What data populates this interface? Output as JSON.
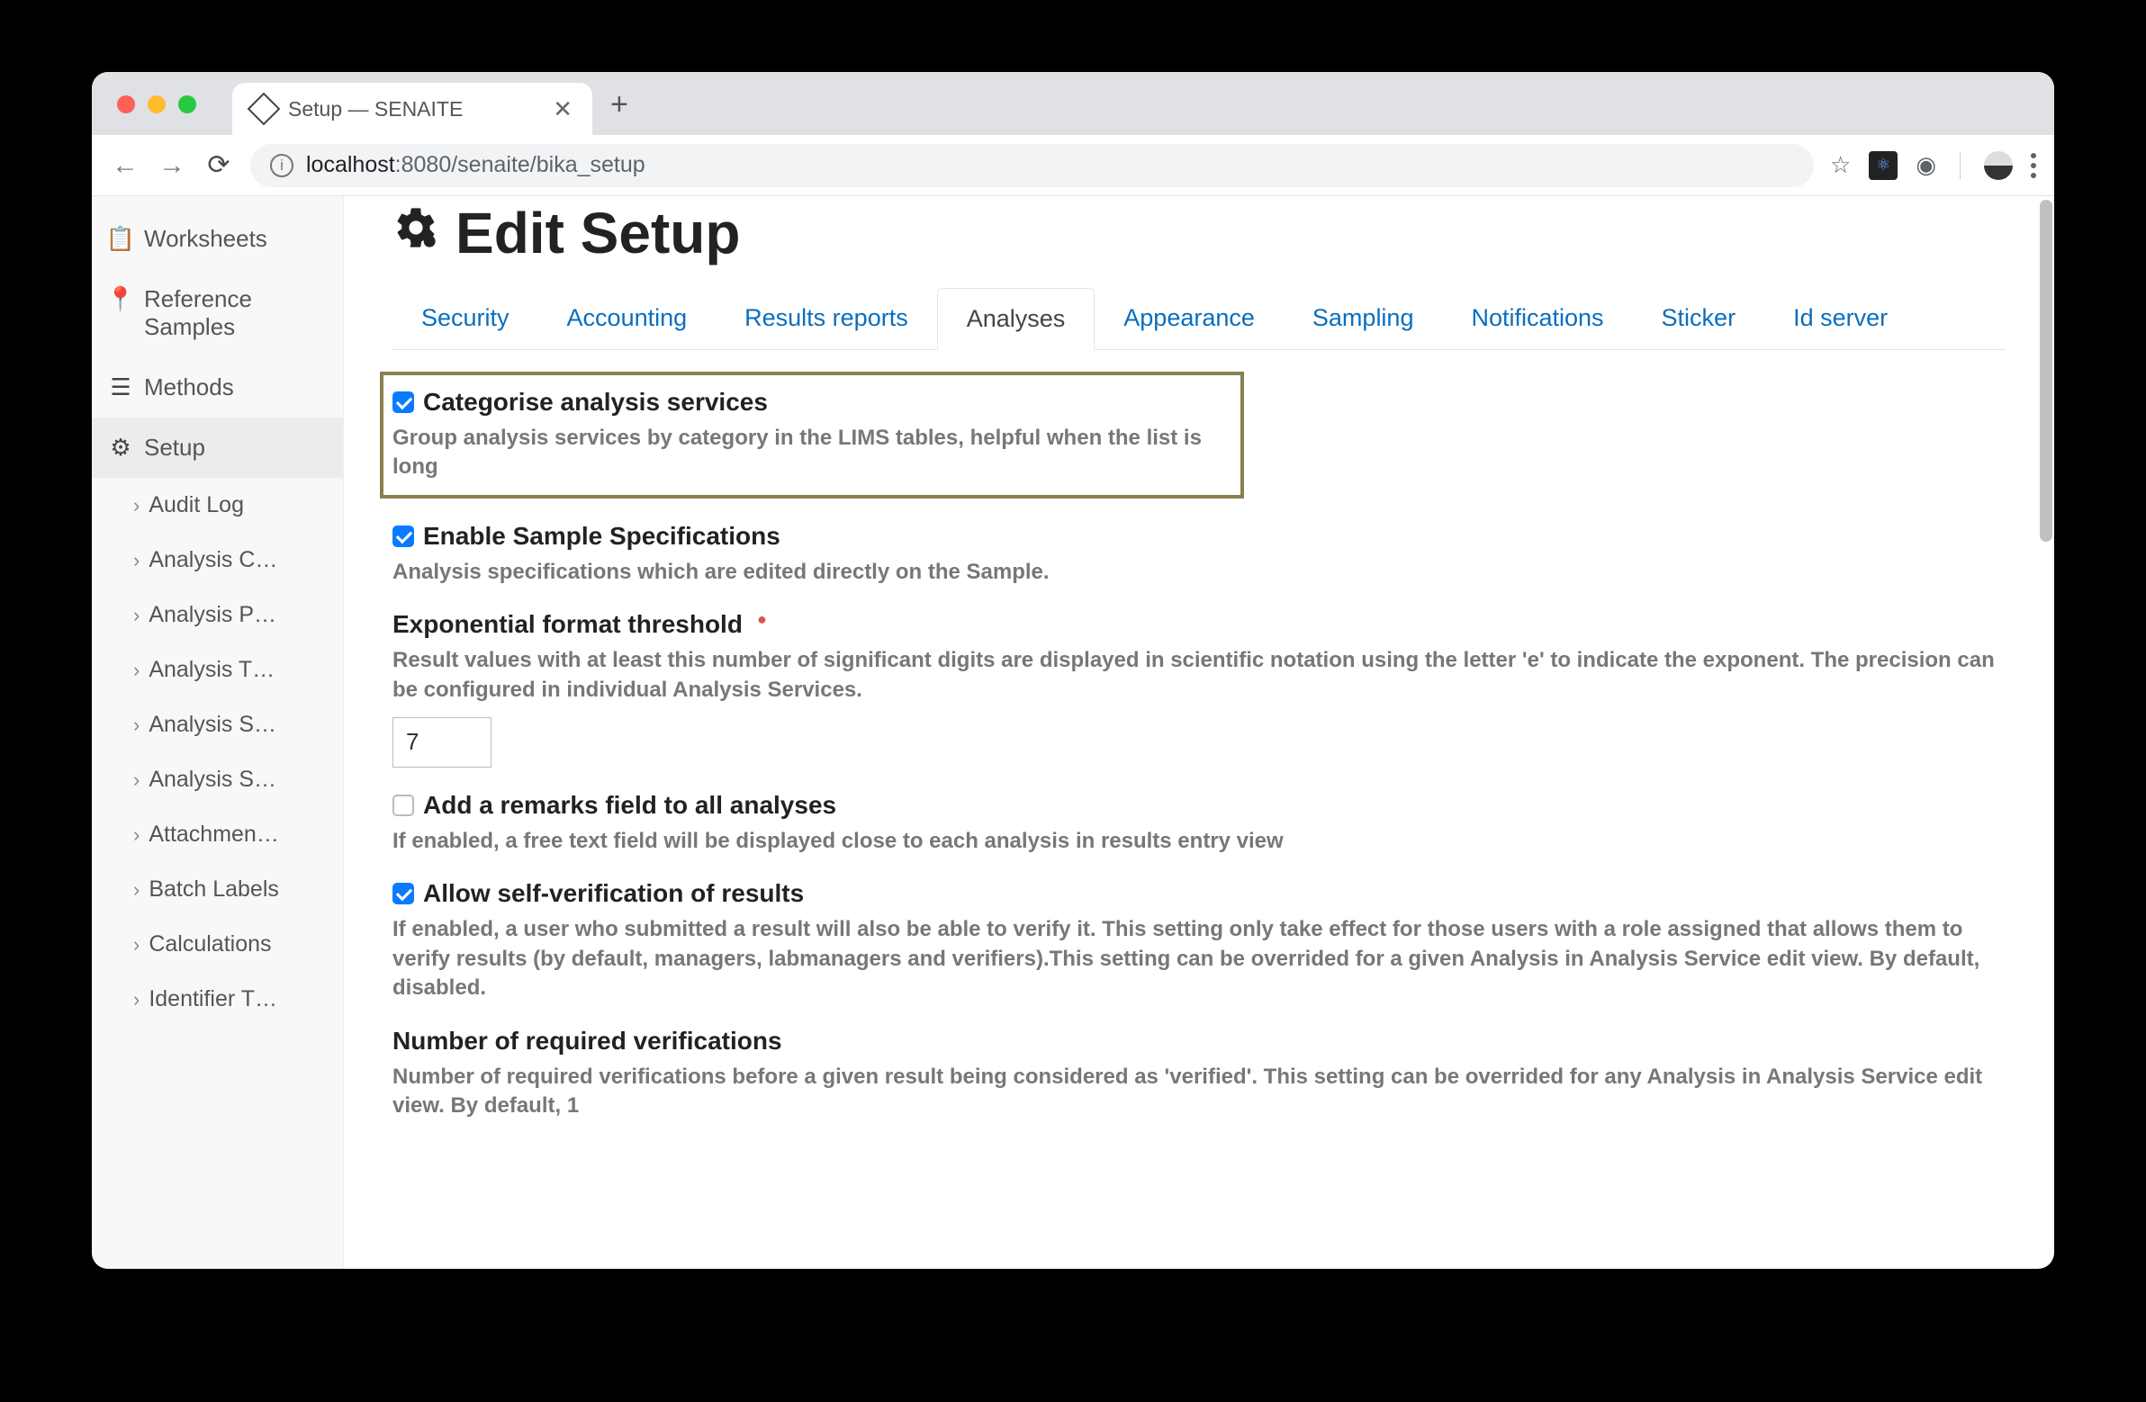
{
  "browser": {
    "tab_title": "Setup — SENAITE",
    "url_host": "localhost",
    "url_port": ":8080",
    "url_path": "/senaite/bika_setup"
  },
  "sidebar": {
    "items": [
      {
        "label": "Worksheets",
        "icon": "📋"
      },
      {
        "label": "Reference Samples",
        "icon": "📍"
      },
      {
        "label": "Methods",
        "icon": "☰"
      },
      {
        "label": "Setup",
        "icon": "⚙"
      }
    ],
    "subitems": [
      {
        "label": "Audit Log"
      },
      {
        "label": "Analysis C…"
      },
      {
        "label": "Analysis P…"
      },
      {
        "label": "Analysis T…"
      },
      {
        "label": "Analysis S…"
      },
      {
        "label": "Analysis S…"
      },
      {
        "label": "Attachmen…"
      },
      {
        "label": "Batch Labels"
      },
      {
        "label": "Calculations"
      },
      {
        "label": "Identifier T…"
      }
    ]
  },
  "page": {
    "title": "Edit Setup"
  },
  "tabs": [
    {
      "label": "Security",
      "active": false
    },
    {
      "label": "Accounting",
      "active": false
    },
    {
      "label": "Results reports",
      "active": false
    },
    {
      "label": "Analyses",
      "active": true
    },
    {
      "label": "Appearance",
      "active": false
    },
    {
      "label": "Sampling",
      "active": false
    },
    {
      "label": "Notifications",
      "active": false
    },
    {
      "label": "Sticker",
      "active": false
    },
    {
      "label": "Id server",
      "active": false
    }
  ],
  "fields": {
    "categorise": {
      "label": "Categorise analysis services",
      "desc": "Group analysis services by category in the LIMS tables, helpful when the list is long",
      "checked": true
    },
    "enable_spec": {
      "label": "Enable Sample Specifications",
      "desc": "Analysis specifications which are edited directly on the Sample.",
      "checked": true
    },
    "exp_threshold": {
      "label": "Exponential format threshold",
      "desc": "Result values with at least this number of significant digits are displayed in scientific notation using the letter 'e' to indicate the exponent. The precision can be configured in individual Analysis Services.",
      "required": true,
      "value": "7"
    },
    "remarks": {
      "label": "Add a remarks field to all analyses",
      "desc": "If enabled, a free text field will be displayed close to each analysis in results entry view",
      "checked": false
    },
    "self_verify": {
      "label": "Allow self-verification of results",
      "desc": "If enabled, a user who submitted a result will also be able to verify it. This setting only take effect for those users with a role assigned that allows them to verify results (by default, managers, labmanagers and verifiers).This setting can be overrided for a given Analysis in Analysis Service edit view. By default, disabled.",
      "checked": true
    },
    "num_verif": {
      "label": "Number of required verifications",
      "desc": "Number of required verifications before a given result being considered as 'verified'. This setting can be overrided for any Analysis in Analysis Service edit view. By default, 1"
    }
  }
}
